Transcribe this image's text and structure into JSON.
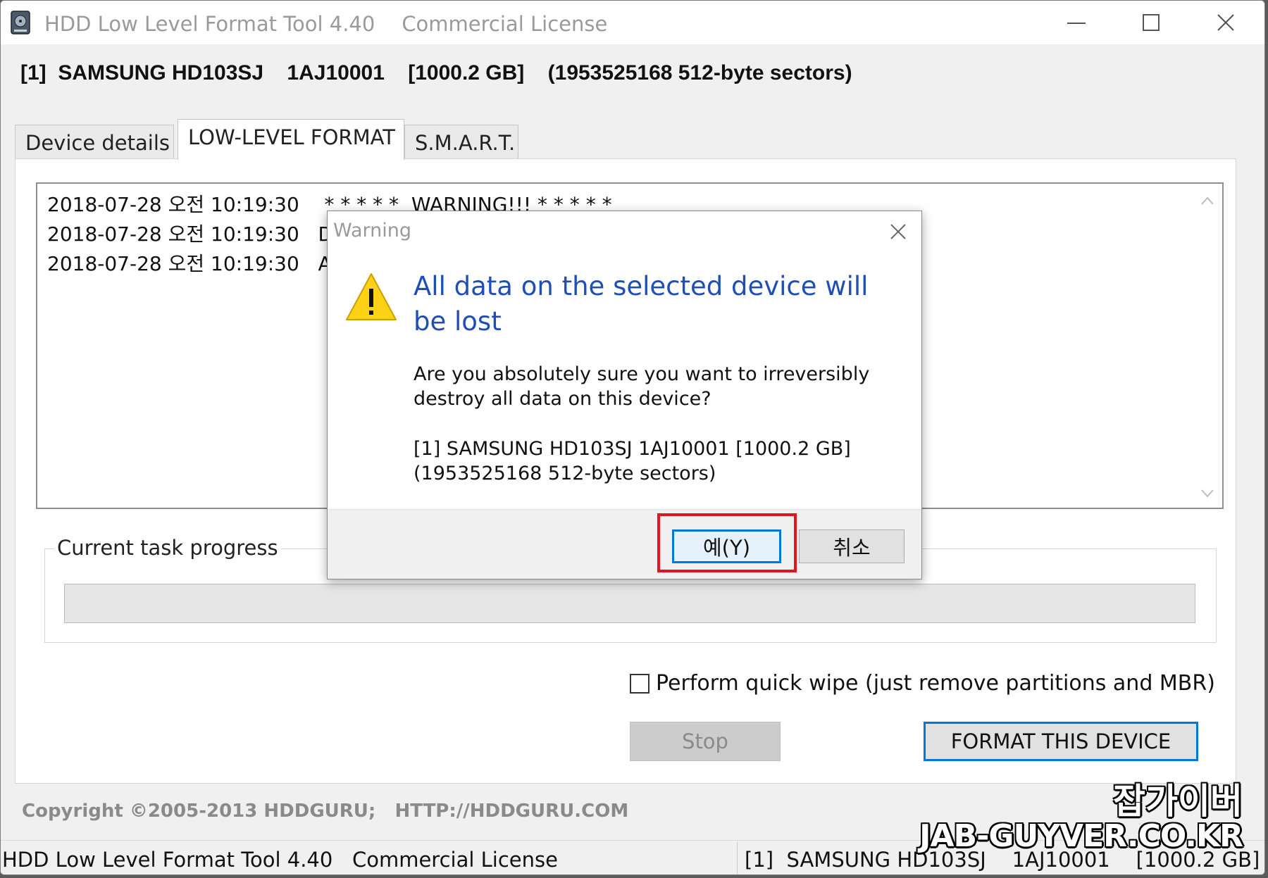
{
  "window": {
    "app_title": "HDD Low Level Format Tool 4.40",
    "license": "Commercial License",
    "minimize_icon": "minimize-icon",
    "maximize_icon": "maximize-icon",
    "close_icon": "close-icon"
  },
  "device_header": "[1]  SAMSUNG HD103SJ    1AJ10001    [1000.2 GB]    (1953525168 512-byte sectors)",
  "tabs": [
    {
      "label": "Device details"
    },
    {
      "label": "LOW-LEVEL FORMAT",
      "active": true
    },
    {
      "label": "S.M.A.R.T."
    }
  ],
  "log": [
    {
      "timestamp": "2018-07-28 오전 10:19:30",
      "message": "* * * * *  WARNING!!! * * * * *"
    },
    {
      "timestamp": "2018-07-28 오전 10:19:30",
      "message": "DU"
    },
    {
      "timestamp": "2018-07-28 오전 10:19:30",
      "message": "AL"
    }
  ],
  "progress": {
    "label": "Current task progress",
    "value": 0
  },
  "quick_wipe": {
    "label": "Perform quick wipe (just remove partitions and MBR)",
    "checked": false
  },
  "buttons": {
    "stop": "Stop",
    "format": "FORMAT THIS DEVICE"
  },
  "copyright": "Copyright ©2005-2013 HDDGURU;   HTTP://HDDGURU.COM",
  "statusbar": {
    "left": "HDD Low Level Format Tool 4.40   Commercial License",
    "right": "[1]  SAMSUNG HD103SJ    1AJ10001    [1000.2 GB]"
  },
  "dialog": {
    "title": "Warning",
    "icon": "warning-icon",
    "heading": "All data on the selected device will be lost",
    "question": "Are you absolutely sure you want to irreversibly destroy all data on this device?",
    "device_line1": "[1]  SAMSUNG HD103SJ    1AJ10001    [1000.2 GB]",
    "device_line2": "(1953525168 512-byte sectors)",
    "yes_label": "예(Y)",
    "cancel_label": "취소"
  },
  "watermark": {
    "line1": "잡가이버",
    "line2": "JAB-GUYVER.CO.KR"
  },
  "colors": {
    "accent": "#0078d7",
    "heading_blue": "#1f4fb5",
    "highlight_red": "#e3141c",
    "warning_yellow": "#fcd116"
  }
}
